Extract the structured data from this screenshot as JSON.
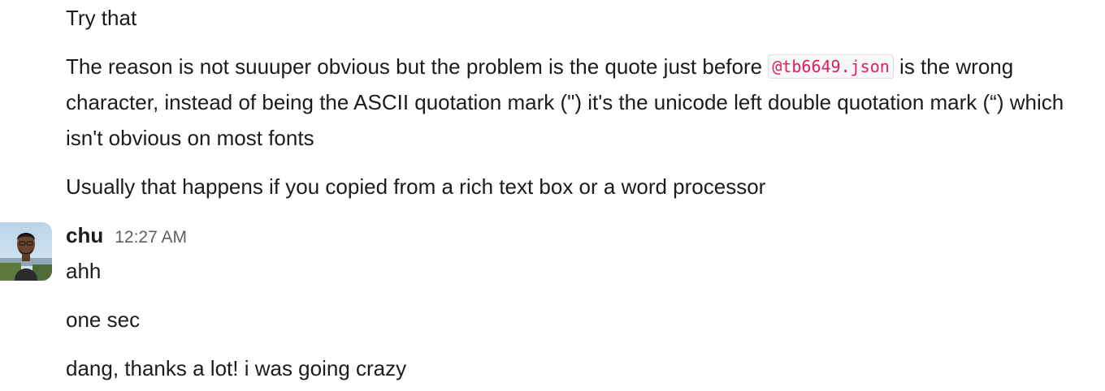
{
  "messages_before": {
    "m1": "Try that",
    "m2": {
      "before": "The reason is not suuuper obvious but the problem is the quote just before ",
      "code": "@tb6649.json",
      "after": " is the wrong character, instead of being the ASCII quotation mark (\") it's the unicode left double quotation mark (“) which isn't obvious on most fonts"
    },
    "m3": "Usually that happens if you copied from a rich text box or a word processor"
  },
  "reply": {
    "author": "chu",
    "timestamp": "12:27 AM",
    "avatar_icon": "user-photo-avatar",
    "m1": "ahh",
    "m2": "one sec",
    "m3": "dang, thanks a lot! i was going crazy"
  },
  "colors": {
    "text": "#1d1c1d",
    "timestamp": "#616061",
    "code_text": "#e01e5a",
    "code_background": "#f8f8f8",
    "code_border": "#dddddd"
  }
}
